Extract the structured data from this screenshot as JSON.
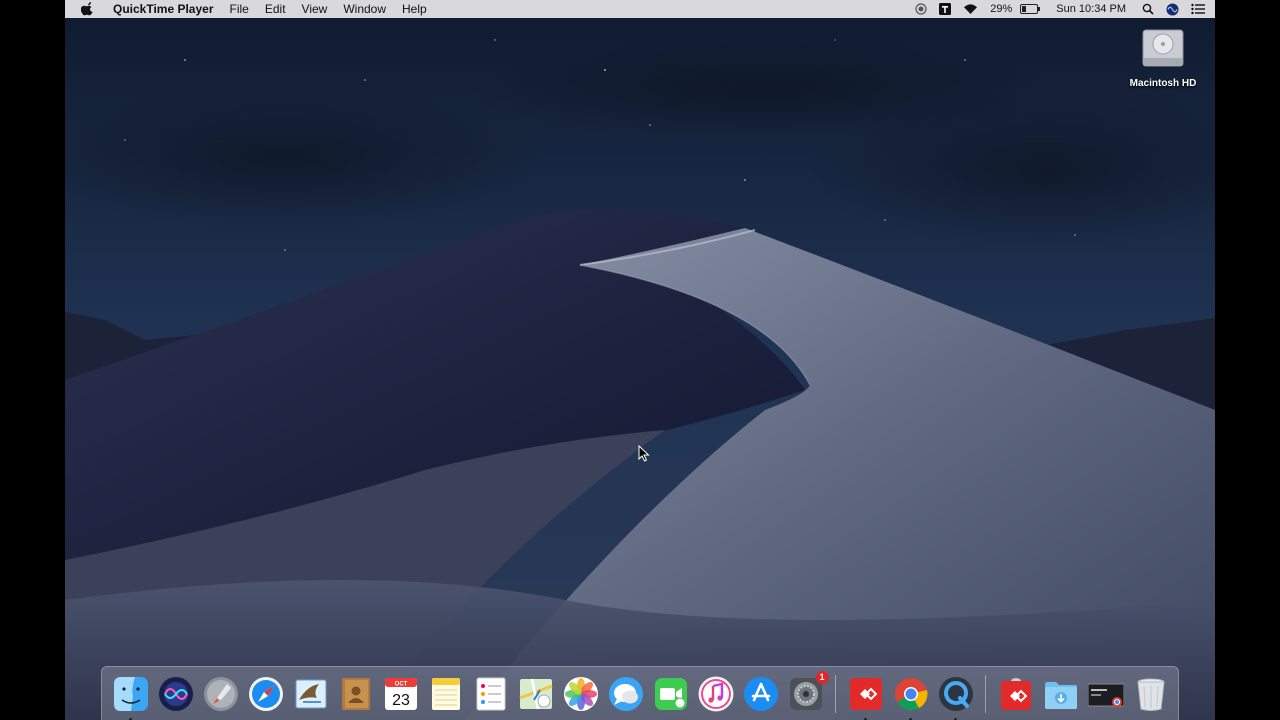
{
  "menubar": {
    "app_name": "QuickTime Player",
    "menus": [
      "File",
      "Edit",
      "View",
      "Window",
      "Help"
    ],
    "battery_percent": "29%",
    "battery_level": 0.29,
    "clock": "Sun 10:34 PM",
    "status_icons": [
      "screen-record-icon",
      "t-app-icon",
      "wifi-icon",
      "battery-icon",
      "spotlight-icon",
      "siri-icon",
      "notification-center-icon"
    ]
  },
  "desktop": {
    "drive_label": "Macintosh HD"
  },
  "dock": {
    "apps": [
      {
        "name": "finder",
        "running": true
      },
      {
        "name": "siri",
        "running": false
      },
      {
        "name": "launchpad",
        "running": false
      },
      {
        "name": "safari",
        "running": false
      },
      {
        "name": "mail",
        "running": false
      },
      {
        "name": "contacts",
        "running": false
      },
      {
        "name": "calendar",
        "running": false,
        "month": "OCT",
        "day": "23"
      },
      {
        "name": "notes",
        "running": false
      },
      {
        "name": "reminders",
        "running": false
      },
      {
        "name": "maps",
        "running": false
      },
      {
        "name": "photos",
        "running": false
      },
      {
        "name": "messages",
        "running": false
      },
      {
        "name": "facetime",
        "running": false
      },
      {
        "name": "itunes",
        "running": false
      },
      {
        "name": "app-store",
        "running": false
      },
      {
        "name": "system-preferences",
        "running": false,
        "badge": "1"
      }
    ],
    "recent_apps": [
      {
        "name": "anydesk",
        "running": true
      },
      {
        "name": "chrome",
        "running": true
      },
      {
        "name": "quicktime",
        "running": true
      }
    ],
    "stacks": [
      {
        "name": "anydesk-download"
      },
      {
        "name": "downloads-folder"
      },
      {
        "name": "screenshot-stack"
      },
      {
        "name": "trash"
      }
    ]
  },
  "colors": {
    "menubar": "#d9d9dc",
    "sky": "#1b2a45",
    "dune_light": "#6b7489",
    "dune_dark": "#1a2036"
  }
}
